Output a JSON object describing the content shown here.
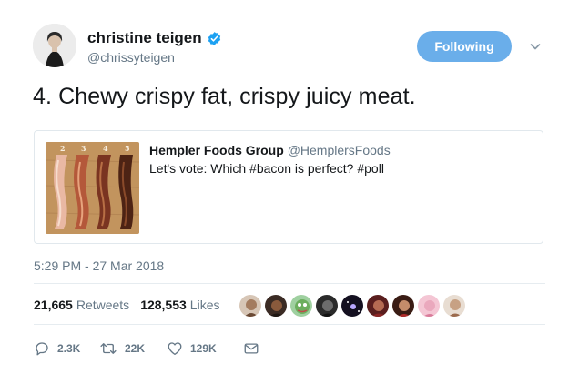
{
  "author": {
    "name": "christine teigen",
    "handle": "@chrissyteigen",
    "verified": true
  },
  "follow_button": {
    "label": "Following",
    "color": "#6aaeea"
  },
  "tweet": {
    "text": "4. Chewy crispy fat, crispy juicy meat.",
    "timestamp": "5:29 PM - 27 Mar 2018"
  },
  "quoted_tweet": {
    "name": "Hempler Foods Group",
    "handle": "@HemplersFoods",
    "text": "Let's vote: Which #bacon is perfect? #poll",
    "image_numbers": [
      "2",
      "3",
      "4",
      "5"
    ]
  },
  "stats": {
    "retweets_count": "21,665",
    "retweets_label": "Retweets",
    "likes_count": "128,553",
    "likes_label": "Likes",
    "liker_count": 9
  },
  "actions": {
    "reply_count": "2.3K",
    "retweet_count": "22K",
    "like_count": "129K"
  },
  "icons": {
    "verified": "verified-badge-icon",
    "caret": "chevron-down-icon",
    "reply": "reply-icon",
    "retweet": "retweet-icon",
    "like": "heart-icon",
    "dm": "envelope-icon"
  },
  "colors": {
    "accent": "#1da1f2",
    "secondary_text": "#657786",
    "border": "#e1e8ed"
  }
}
